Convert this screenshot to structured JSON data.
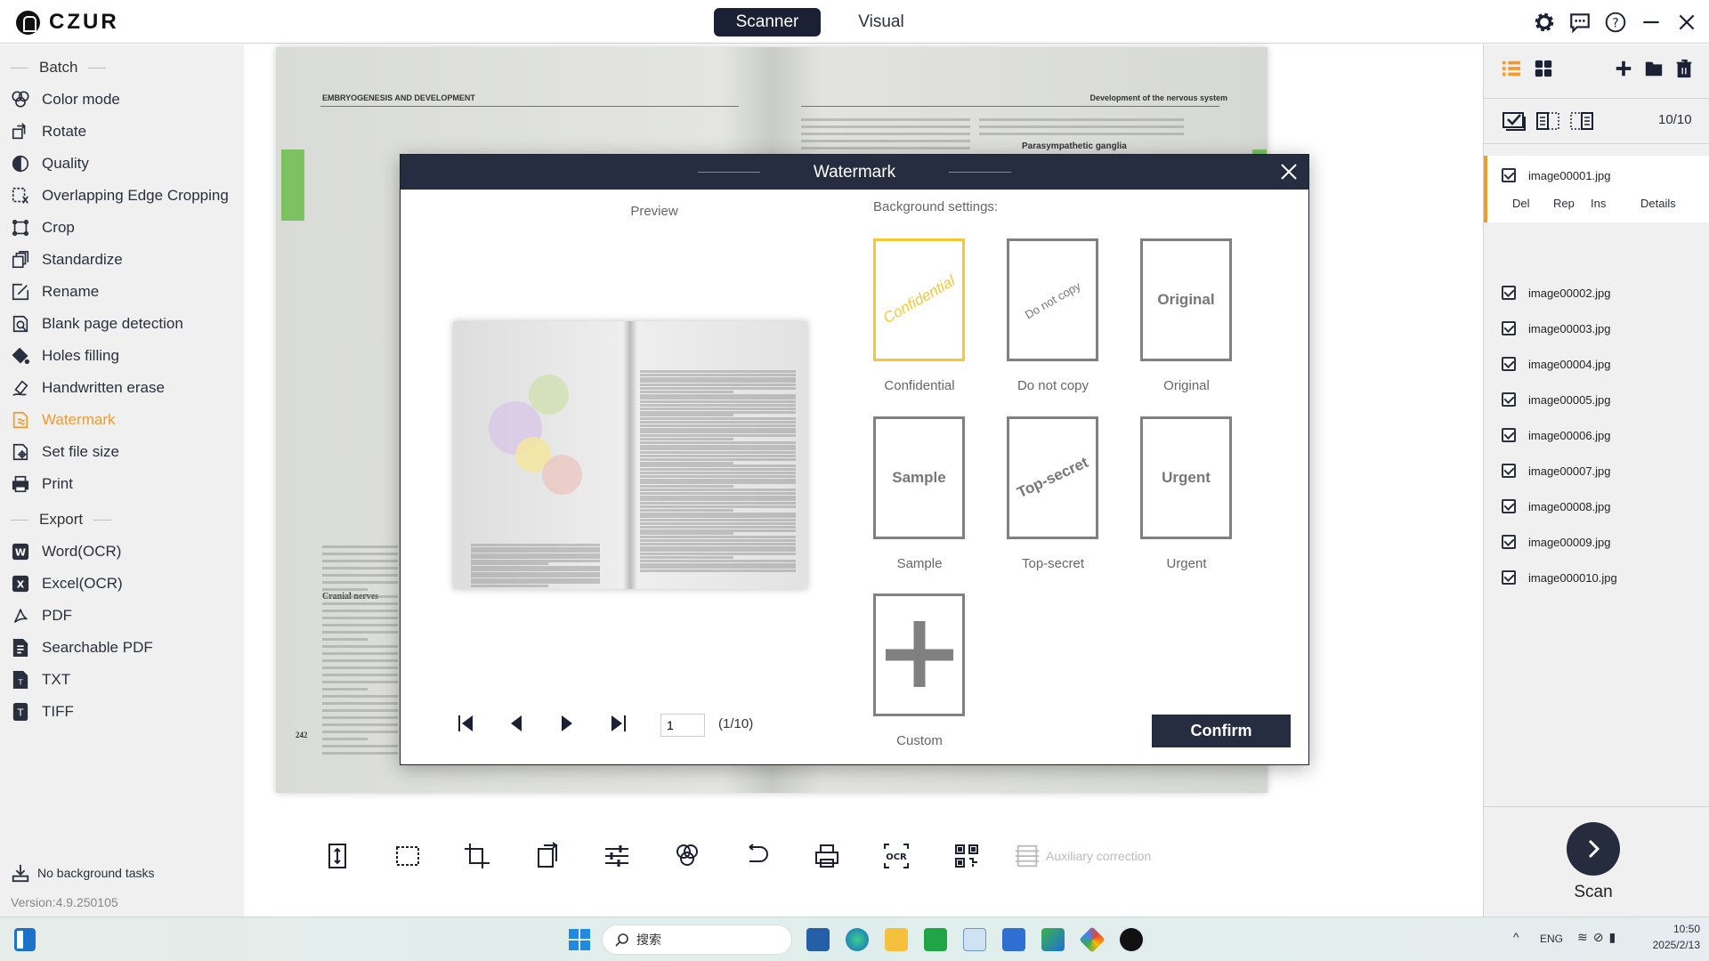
{
  "app": {
    "logo_text": "CZUR",
    "tabs": [
      {
        "label": "Scanner",
        "active": true
      },
      {
        "label": "Visual",
        "active": false
      }
    ],
    "header_icons": [
      "gear-icon",
      "chat-icon",
      "help-icon",
      "minimize-icon",
      "close-icon"
    ]
  },
  "sidebar": {
    "batch_title": "Batch",
    "batch_items": [
      {
        "label": "Color mode",
        "icon": "color-mode-icon"
      },
      {
        "label": "Rotate",
        "icon": "rotate-icon"
      },
      {
        "label": "Quality",
        "icon": "quality-icon"
      },
      {
        "label": "Overlapping Edge Cropping",
        "icon": "edge-crop-icon"
      },
      {
        "label": "Crop",
        "icon": "crop-icon"
      },
      {
        "label": "Standardize",
        "icon": "standardize-icon"
      },
      {
        "label": "Rename",
        "icon": "rename-icon"
      },
      {
        "label": "Blank page detection",
        "icon": "blank-page-icon"
      },
      {
        "label": "Holes filling",
        "icon": "paint-bucket-icon"
      },
      {
        "label": "Handwritten erase",
        "icon": "eraser-icon"
      },
      {
        "label": "Watermark",
        "icon": "watermark-icon",
        "active": true
      },
      {
        "label": "Set file size",
        "icon": "file-size-icon"
      },
      {
        "label": "Print",
        "icon": "print-icon"
      }
    ],
    "export_title": "Export",
    "export_items": [
      {
        "label": "Word(OCR)",
        "icon": "word-icon"
      },
      {
        "label": "Excel(OCR)",
        "icon": "excel-icon"
      },
      {
        "label": "PDF",
        "icon": "pdf-icon"
      },
      {
        "label": "Searchable PDF",
        "icon": "searchable-pdf-icon"
      },
      {
        "label": "TXT",
        "icon": "txt-icon"
      },
      {
        "label": "TIFF",
        "icon": "tiff-icon"
      }
    ],
    "background_tasks": "No background tasks",
    "version": "Version:4.9.250105",
    "accent": "#f29a2e"
  },
  "document": {
    "left_header": "EMBRYOGENESIS AND DEVELOPMENT",
    "right_header": "Development of the nervous system",
    "subheading_left": "Cranial nerves",
    "subheading_right": "Parasympathetic ganglia",
    "page_number": "242"
  },
  "toolbar": {
    "items": [
      "split-icon",
      "select-icon",
      "crop-icon",
      "rotate-icon",
      "adjust-icon",
      "color-mode-icon",
      "undo-icon",
      "print-icon",
      "ocr-icon",
      "qr-code-icon"
    ],
    "auxiliary": "Auxiliary correction"
  },
  "right_panel": {
    "count": "10/10",
    "files": [
      "image00001.jpg",
      "image00002.jpg",
      "image00003.jpg",
      "image00004.jpg",
      "image00005.jpg",
      "image00006.jpg",
      "image00007.jpg",
      "image00008.jpg",
      "image00009.jpg",
      "image000010.jpg"
    ],
    "file_actions": [
      "Del",
      "Rep",
      "Ins",
      "Details"
    ],
    "scan_label": "Scan"
  },
  "modal": {
    "title": "Watermark",
    "preview_label": "Preview",
    "background_label": "Background settings:",
    "page_input": "1",
    "page_count": "(1/10)",
    "options": [
      {
        "label": "Confidential",
        "mark": "Confidential",
        "selected": true
      },
      {
        "label": "Do not copy",
        "mark": "Do not copy"
      },
      {
        "label": "Original",
        "mark": "Original"
      },
      {
        "label": "Sample",
        "mark": "Sample"
      },
      {
        "label": "Top-secret",
        "mark": "Top-secret"
      },
      {
        "label": "Urgent",
        "mark": "Urgent"
      },
      {
        "label": "Custom",
        "mark": "+"
      }
    ],
    "confirm": "Confirm",
    "selected_color": "#f6c934"
  },
  "taskbar": {
    "search_placeholder": "搜索",
    "lang": "ENG",
    "time": "10:50",
    "date": "2025/2/13"
  }
}
